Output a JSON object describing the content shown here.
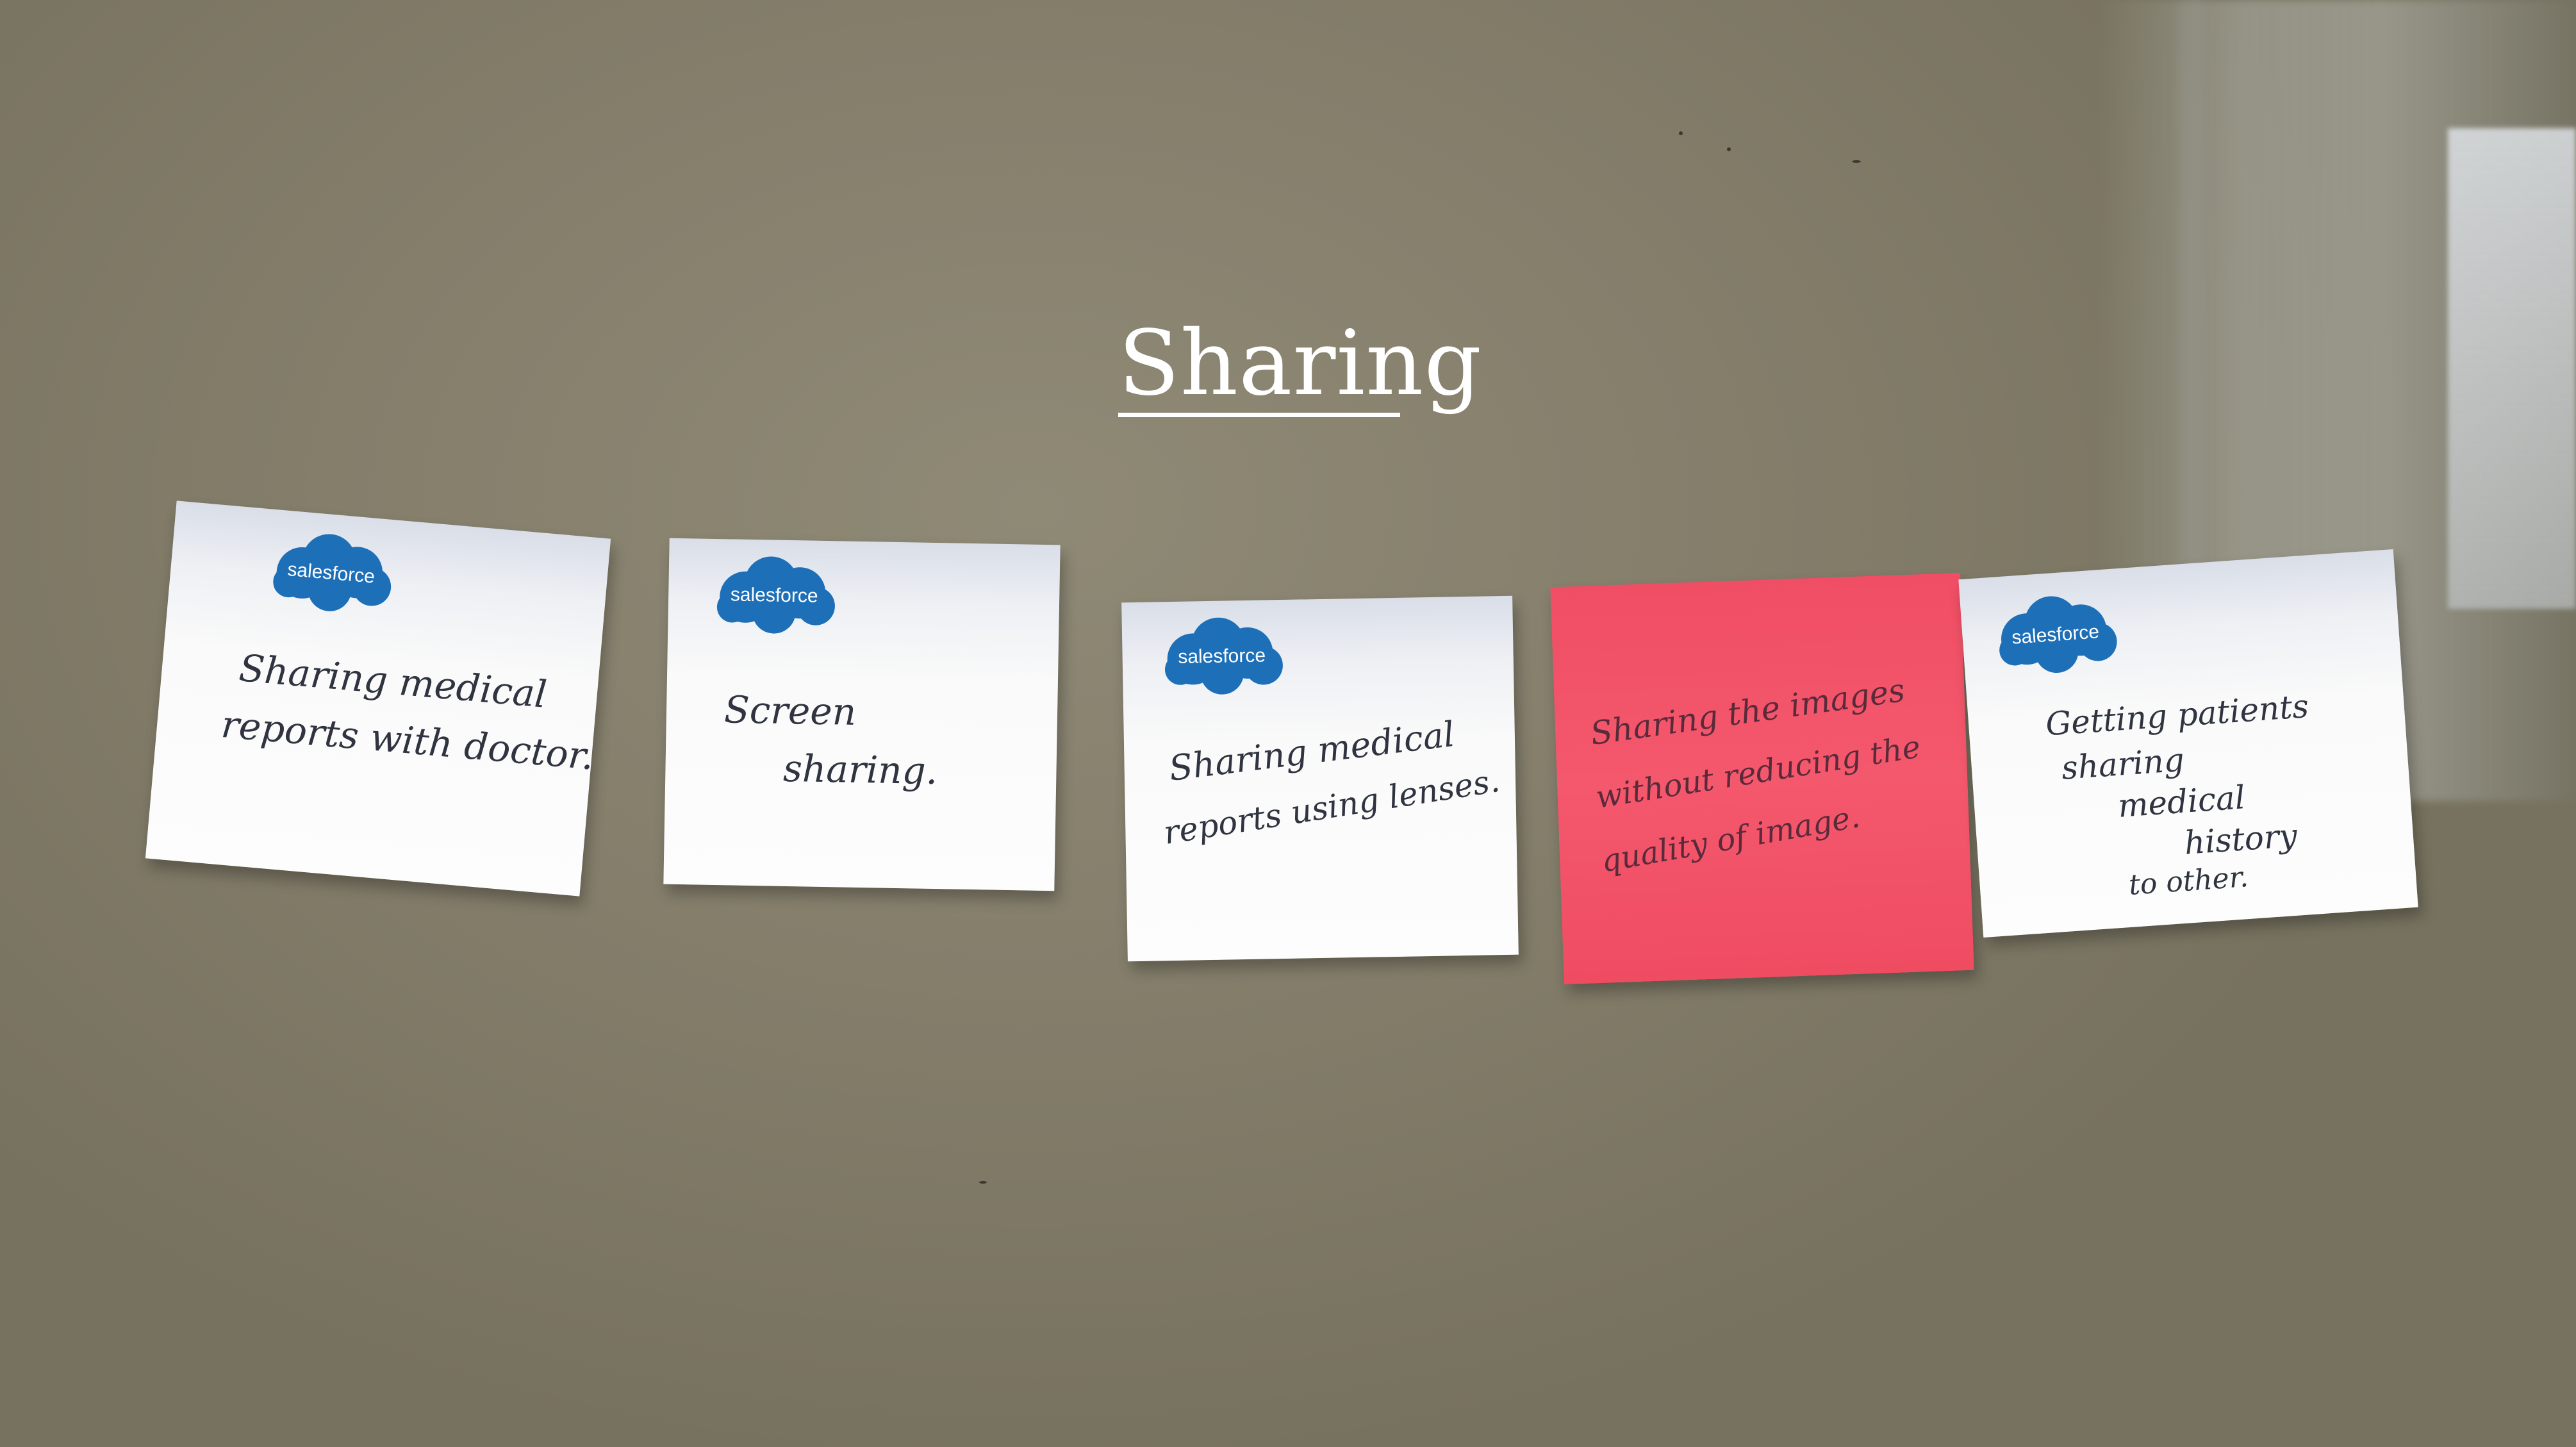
{
  "board": {
    "title": "Sharing"
  },
  "notes": [
    {
      "color": "white",
      "logo": "salesforce",
      "lines": [
        "Sharing medical",
        "reports with doctor."
      ]
    },
    {
      "color": "white",
      "logo": "salesforce",
      "lines": [
        "Screen",
        "    sharing."
      ]
    },
    {
      "color": "white",
      "logo": "salesforce",
      "lines": [
        "Sharing medical",
        "reports using lenses."
      ]
    },
    {
      "color": "pink",
      "lines": [
        "Sharing the images",
        "without reducing the",
        "quality of image."
      ]
    },
    {
      "color": "white",
      "logo": "salesforce",
      "lines": [
        "Getting patients",
        "sharing",
        "    medical",
        "         history",
        "   to other."
      ]
    }
  ],
  "colors": {
    "wall": "#857f6c",
    "note_white": "#fdfdfd",
    "note_pink": "#f4586d",
    "salesforce_blue": "#1d6fb8",
    "ink": "#2f3440"
  }
}
